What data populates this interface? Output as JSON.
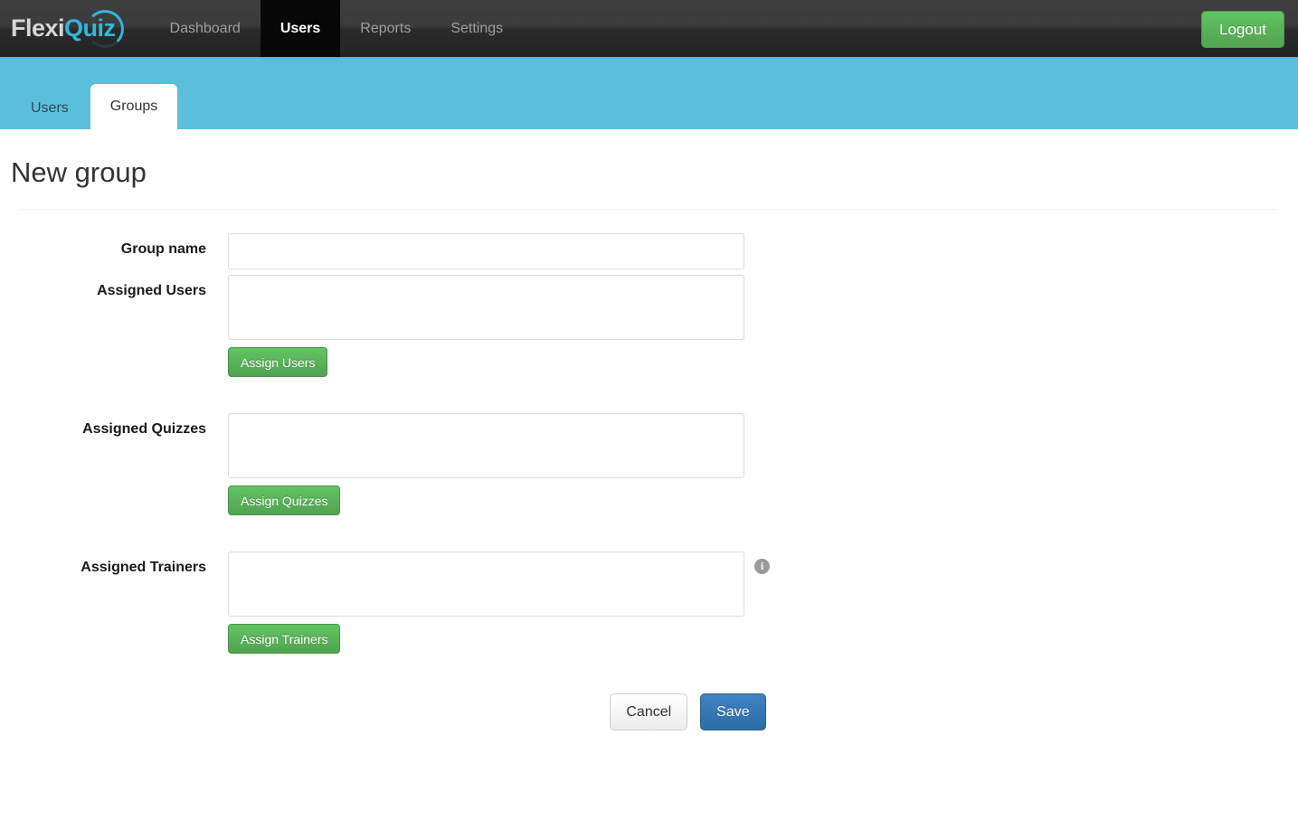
{
  "brand": {
    "name_part1": "Flexi",
    "name_part2": "Quiz"
  },
  "navbar": {
    "items": [
      {
        "label": "Dashboard",
        "active": false
      },
      {
        "label": "Users",
        "active": true
      },
      {
        "label": "Reports",
        "active": false
      },
      {
        "label": "Settings",
        "active": false
      }
    ],
    "logout_label": "Logout",
    "background_color": "#2b2b2b",
    "accent_color": "#4fb6d4"
  },
  "tabbar": {
    "background_color": "#5bbfdc",
    "tabs": [
      {
        "label": "Users",
        "active": false
      },
      {
        "label": "Groups",
        "active": true
      }
    ]
  },
  "page": {
    "title": "New group"
  },
  "form": {
    "group_name": {
      "label": "Group name",
      "value": "",
      "placeholder": ""
    },
    "assigned_users": {
      "label": "Assigned Users",
      "value": "",
      "placeholder": "",
      "button_label": "Assign Users"
    },
    "assigned_quizzes": {
      "label": "Assigned Quizzes",
      "value": "",
      "placeholder": "",
      "button_label": "Assign Quizzes"
    },
    "assigned_trainers": {
      "label": "Assigned Trainers",
      "value": "",
      "placeholder": "",
      "button_label": "Assign Trainers",
      "info_icon": "info-icon",
      "info_glyph": "i"
    }
  },
  "actions": {
    "cancel_label": "Cancel",
    "save_label": "Save",
    "save_color": "#2c6ca4",
    "assign_button_color": "#51a351"
  }
}
